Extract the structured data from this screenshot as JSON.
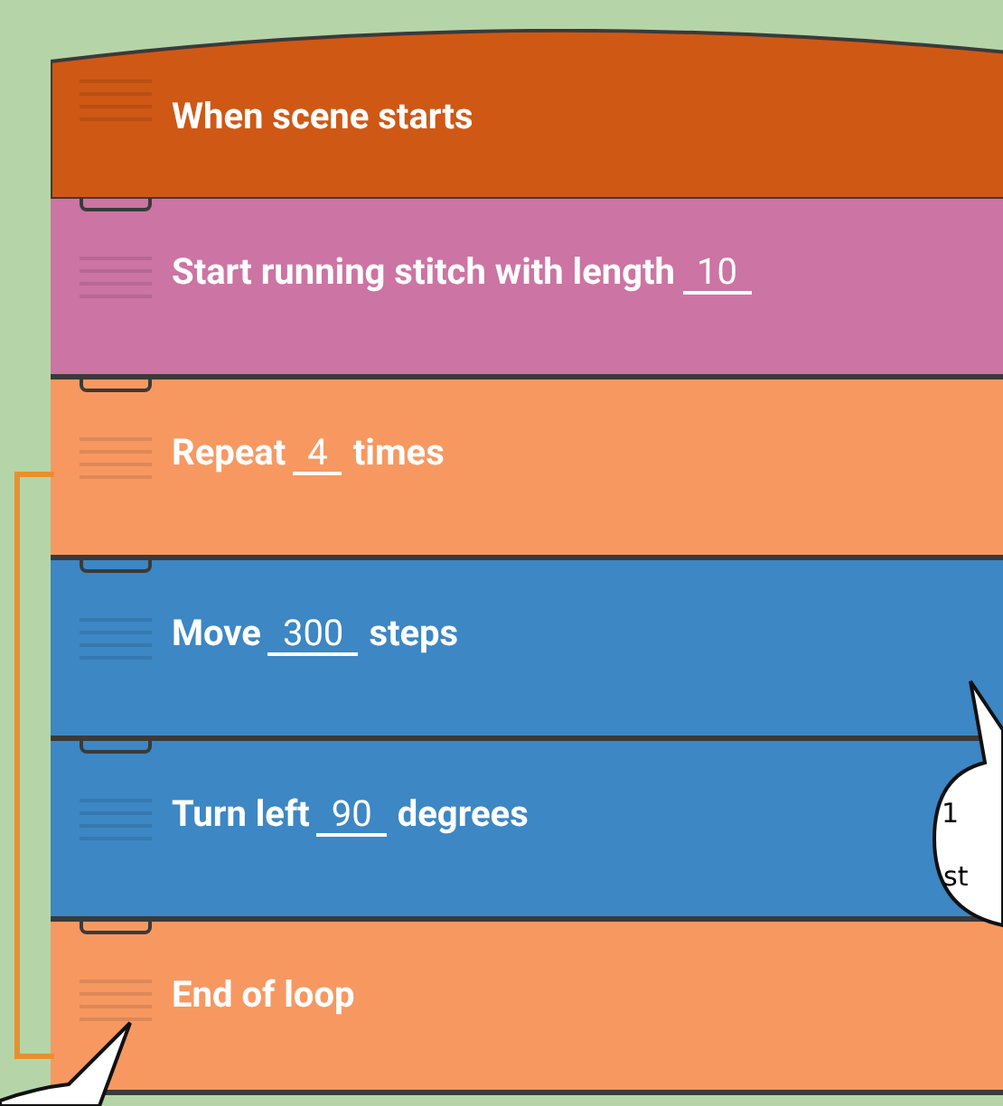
{
  "blocks": [
    {
      "kind": "event",
      "color": "#cf5815",
      "text": "When scene starts"
    },
    {
      "kind": "input",
      "color": "#cc74a3",
      "text": "Start running stitch with length",
      "value": "10"
    },
    {
      "kind": "input",
      "color": "#f79861",
      "text": "Repeat",
      "value": "4",
      "after": "times"
    },
    {
      "kind": "input",
      "color": "#3c87c4",
      "text": "Move",
      "value": "300",
      "after": "steps"
    },
    {
      "kind": "input",
      "color": "#3c87c4",
      "text": "Turn left",
      "value": "90",
      "after": "degrees"
    },
    {
      "kind": "plain",
      "color": "#f79861",
      "text": "End of loop"
    }
  ],
  "bubbles": [
    {
      "kind": "right",
      "lines": [
        "1",
        "st"
      ]
    },
    {
      "kind": "bottom_left"
    }
  ]
}
